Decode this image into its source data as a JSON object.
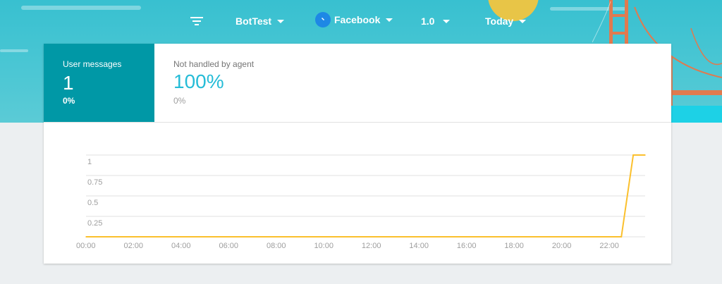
{
  "topbar": {
    "filter_icon": "filter-icon",
    "agent": "BotTest",
    "platform": "Facebook",
    "platform_icon": "messenger-icon",
    "version": "1.0",
    "period": "Today"
  },
  "kpis": {
    "user_messages": {
      "label": "User messages",
      "value": "1",
      "percent": "0%"
    },
    "not_handled": {
      "label": "Not handled by agent",
      "value": "100%",
      "percent": "0%"
    }
  },
  "colors": {
    "primary_tile": "#0098a6",
    "kpi_value": "#26bcd7",
    "series": "#fbc02d"
  },
  "chart_data": {
    "type": "line",
    "x": [
      "00:00",
      "00:30",
      "01:00",
      "01:30",
      "02:00",
      "02:30",
      "03:00",
      "03:30",
      "04:00",
      "04:30",
      "05:00",
      "05:30",
      "06:00",
      "06:30",
      "07:00",
      "07:30",
      "08:00",
      "08:30",
      "09:00",
      "09:30",
      "10:00",
      "10:30",
      "11:00",
      "11:30",
      "12:00",
      "12:30",
      "13:00",
      "13:30",
      "14:00",
      "14:30",
      "15:00",
      "15:30",
      "16:00",
      "16:30",
      "17:00",
      "17:30",
      "18:00",
      "18:30",
      "19:00",
      "19:30",
      "20:00",
      "20:30",
      "21:00",
      "21:30",
      "22:00",
      "22:30",
      "23:00",
      "23:30"
    ],
    "series": [
      {
        "values": [
          0,
          0,
          0,
          0,
          0,
          0,
          0,
          0,
          0,
          0,
          0,
          0,
          0,
          0,
          0,
          0,
          0,
          0,
          0,
          0,
          0,
          0,
          0,
          0,
          0,
          0,
          0,
          0,
          0,
          0,
          0,
          0,
          0,
          0,
          0,
          0,
          0,
          0,
          0,
          0,
          0,
          0,
          0,
          0,
          0,
          0,
          1,
          1
        ]
      }
    ],
    "x_tick_labels": [
      "00:00",
      "02:00",
      "04:00",
      "06:00",
      "08:00",
      "10:00",
      "12:00",
      "14:00",
      "16:00",
      "18:00",
      "20:00",
      "22:00"
    ],
    "y_tick_labels": [
      "0.25",
      "0.5",
      "0.75",
      "1"
    ],
    "ylim": [
      0,
      1
    ],
    "grid": true
  }
}
